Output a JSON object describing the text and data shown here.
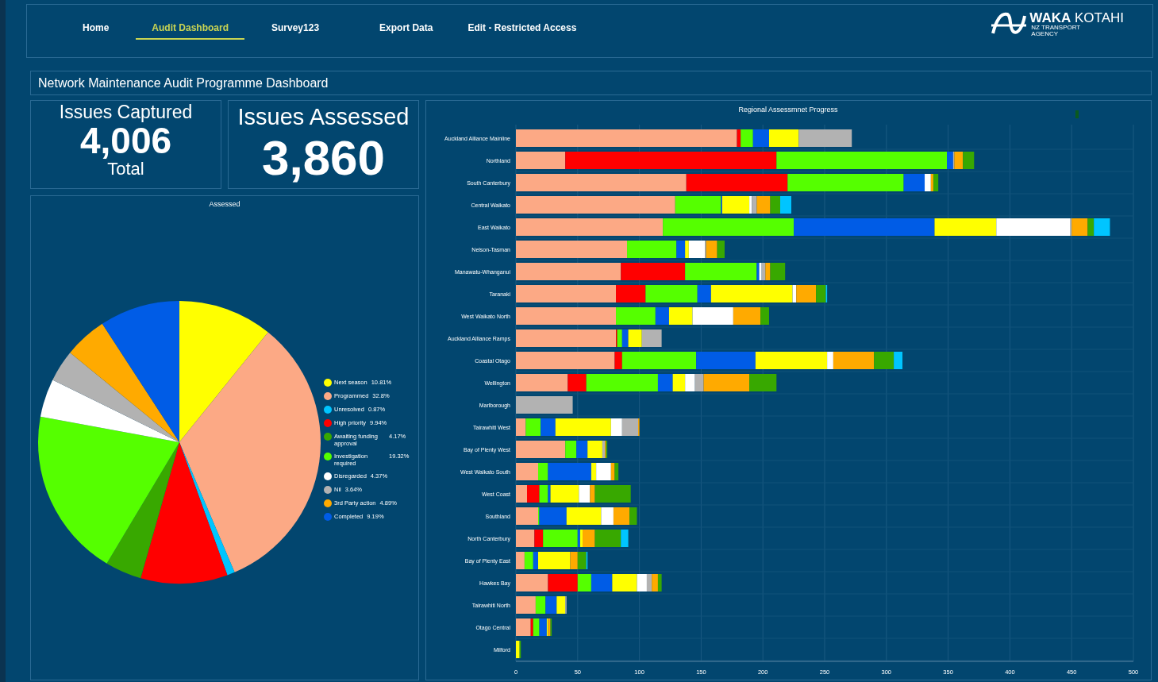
{
  "nav": {
    "items": [
      {
        "label": "Home",
        "selected": false
      },
      {
        "label": "Audit Dashboard",
        "selected": true
      },
      {
        "label": "Survey123",
        "selected": false
      },
      {
        "label": "Export Data",
        "selected": false
      },
      {
        "label": "Edit - Restricted Access",
        "selected": false
      }
    ],
    "logo": {
      "bold": "WAKA",
      "light": "KOTAHI",
      "sub1": "NZ TRANSPORT",
      "sub2": "AGENCY"
    }
  },
  "title": "Network Maintenance Audit Programme Dashboard",
  "cards": [
    {
      "kind": "captured",
      "title": "Issues Captured",
      "value": "4,006",
      "caption": "Total"
    },
    {
      "kind": "assessed",
      "title": "Issues Assessed",
      "value": "3,860"
    }
  ],
  "pie": {
    "title": "Assessed",
    "chart_data": {
      "type": "pie",
      "categories": [
        "Next season",
        "Programmed",
        "Unresolved",
        "High priority",
        "Awaiting funding approval",
        "Investigation required",
        "Disregarded",
        "Nil",
        "3rd Party action",
        "Completed"
      ],
      "values": [
        10.81,
        32.8,
        0.87,
        9.94,
        4.17,
        19.32,
        4.37,
        3.64,
        4.89,
        9.19
      ]
    },
    "legend": [
      {
        "pct": "10.81%",
        "color": "#ffff00"
      },
      {
        "pct": "32.8%",
        "color": "#fca985"
      },
      {
        "pct": "0.87%",
        "color": "#00c5ff"
      },
      {
        "pct": "9.94%",
        "color": "#ff0000"
      },
      {
        "pct": "4.17%",
        "color": "#38a800"
      },
      {
        "pct": "19.32%",
        "color": "#55ff00"
      },
      {
        "pct": "4.37%",
        "color": "#ffffff"
      },
      {
        "pct": "3.64%",
        "color": "#b2b2b2"
      },
      {
        "pct": "4.89%",
        "color": "#ffaa00"
      },
      {
        "pct": "9.19%",
        "color": "#005ce6"
      }
    ]
  },
  "bars": {
    "chart_data": {
      "type": "bar",
      "orientation": "horizontal",
      "stacked": true,
      "title": "Regional Assessmnet Progress",
      "categories": [
        "Auckland Alliance Mainline",
        "Northland",
        "South Canterbury",
        "Central Waikato",
        "East Waikato",
        "Nelson-Tasman",
        "Manawatu-Whanganui",
        "Taranaki",
        "West Waikato North",
        "Auckland Alliance Ramps",
        "Coastal Otago",
        "Wellington",
        "Marlborough",
        "Tairawhiti West",
        "Bay of Plenty West",
        "West Waikato South",
        "West Coast",
        "Southland",
        "North Canterbury",
        "Bay of Plenty East",
        "Hawkes Bay",
        "Tairawhiti North",
        "Otago Central",
        "Milford"
      ],
      "xlim": [
        0,
        500
      ],
      "grid": true,
      "xticks": [
        0,
        50,
        100,
        150,
        200,
        250,
        300,
        350,
        400,
        450,
        500
      ],
      "series": [
        {
          "color": "#fca985",
          "values": [
            179,
            40,
            138,
            129,
            119,
            90,
            85,
            81,
            81,
            81,
            80,
            42,
            0,
            8,
            40,
            18,
            9,
            18,
            15,
            7,
            26,
            16,
            12,
            0
          ]
        },
        {
          "color": "#ff0000",
          "values": [
            3,
            171,
            82,
            0,
            0,
            0,
            52,
            24,
            0,
            1,
            6,
            15,
            0,
            0,
            0,
            0,
            10,
            0,
            7,
            0,
            24,
            0,
            2,
            0
          ]
        },
        {
          "color": "#55ff00",
          "values": [
            10,
            138,
            94,
            37,
            106,
            40,
            58,
            42,
            32,
            4,
            60,
            58,
            0,
            12,
            9,
            8,
            7,
            1,
            28,
            7,
            11,
            8,
            5,
            0
          ]
        },
        {
          "color": "#005ce6",
          "values": [
            13,
            5,
            17,
            1,
            114,
            7,
            2,
            11,
            11,
            5,
            48,
            12,
            0,
            12,
            9,
            35,
            2,
            22,
            2,
            4,
            17,
            9,
            6,
            0
          ]
        },
        {
          "color": "#ffff00",
          "values": [
            24,
            0,
            0,
            22,
            50,
            3,
            0,
            66,
            19,
            11,
            58,
            10,
            0,
            45,
            12,
            4,
            23,
            28,
            2,
            26,
            20,
            7,
            1,
            3
          ]
        },
        {
          "color": "#ffffff",
          "values": [
            0,
            0,
            5,
            2,
            60,
            13,
            2,
            3,
            33,
            0,
            5,
            8,
            0,
            9,
            0,
            12,
            9,
            10,
            0,
            0,
            8,
            0,
            0,
            0
          ]
        },
        {
          "color": "#b2b2b2",
          "values": [
            43,
            1,
            0,
            4,
            1,
            1,
            3,
            0,
            0,
            16,
            0,
            7,
            46,
            13,
            2,
            0,
            0,
            0,
            0,
            0,
            4,
            1,
            0,
            0
          ]
        },
        {
          "color": "#ffaa00",
          "values": [
            0,
            7,
            2,
            11,
            13,
            9,
            4,
            16,
            22,
            0,
            33,
            37,
            0,
            1,
            1,
            3,
            4,
            13,
            10,
            6,
            5,
            0,
            2,
            0
          ]
        },
        {
          "color": "#38a800",
          "values": [
            0,
            9,
            4,
            8,
            5,
            6,
            12,
            8,
            7,
            0,
            16,
            22,
            0,
            0,
            1,
            3,
            29,
            6,
            21,
            7,
            3,
            0,
            1,
            1
          ]
        },
        {
          "color": "#00c5ff",
          "values": [
            0,
            0,
            0,
            9,
            13,
            0,
            0,
            1,
            0,
            0,
            7,
            0,
            0,
            0,
            0,
            0,
            0,
            0,
            6,
            1,
            0,
            0,
            0,
            0
          ]
        }
      ]
    }
  }
}
